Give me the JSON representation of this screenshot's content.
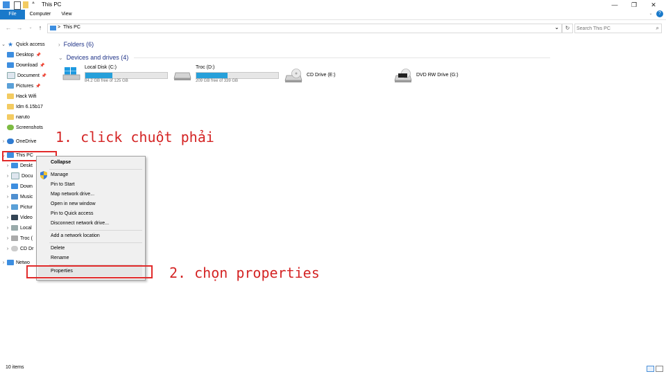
{
  "window": {
    "title": "This PC",
    "controls": [
      "—",
      "❐",
      "✕"
    ]
  },
  "ribbon": {
    "tabs": [
      "File",
      "Computer",
      "View"
    ],
    "help": "?"
  },
  "address": {
    "path_sep": ">",
    "path": "This PC",
    "dropdown": "⌄",
    "refresh": "↻",
    "search_placeholder": "Search This PC",
    "search_icon": "⌕"
  },
  "nav": {
    "quick_access": "Quick access",
    "quick_items": [
      "Desktop",
      "Download",
      "Document",
      "Pictures",
      "Hack Wifi",
      "Idm 6.15b17",
      "naruto",
      "Screenshots"
    ],
    "onedrive": "OneDrive",
    "this_pc": "This PC",
    "this_pc_children": [
      "Deskt",
      "Docu",
      "Down",
      "Music",
      "Pictur",
      "Video",
      "Local",
      "Troc (",
      "CD Dr"
    ],
    "network": "Netwo"
  },
  "content": {
    "folders_header": "Folders (6)",
    "devices_header": "Devices and drives (4)",
    "drives": [
      {
        "name": "Local Disk (C:)",
        "free": "84.2 GB free of 125 GB",
        "used_fraction": 0.33
      },
      {
        "name": "Troc (D:)",
        "free": "209 GB free of 339 GB",
        "used_fraction": 0.38
      },
      {
        "name": "CD Drive (E:)"
      },
      {
        "name": "DVD RW Drive (G:)"
      }
    ]
  },
  "context_menu": {
    "items": [
      "Collapse",
      "Manage",
      "Pin to Start",
      "Map network drive...",
      "Open in new window",
      "Pin to Quick access",
      "Disconnect network drive...",
      "Add a network location",
      "Delete",
      "Rename",
      "Properties"
    ]
  },
  "annotations": {
    "step1": "1. click chuột phải",
    "step2": "2. chọn properties"
  },
  "status": {
    "items": "10 items"
  },
  "colors": {
    "accent": "#1979ca",
    "annotation": "#e12a2a",
    "drive_fill": "#26a0da"
  }
}
